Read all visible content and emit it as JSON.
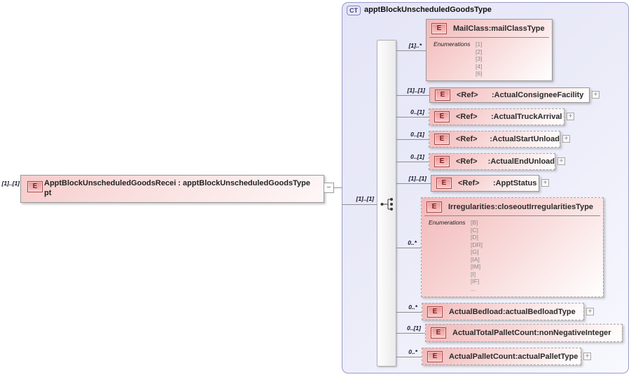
{
  "icons": {
    "element_badge": "E",
    "expander": "+",
    "collapser": "−"
  },
  "root": {
    "cardinality": "[1]..[1]",
    "display_line1": "ApptBlockUnscheduledGoodsRecei : apptBlockUnscheduledGoodsType",
    "display_line2": "pt"
  },
  "ct": {
    "badge": "CT",
    "title": "apptBlockUnscheduledGoodsType",
    "sequence_cardinality": "[1]..[1]",
    "children": [
      {
        "cardinality": "[1]..*",
        "name": "MailClass",
        "sep": " : ",
        "type": "mailClassType",
        "ref": false,
        "optional": false,
        "expander": false,
        "enumerations_label": "Enumerations",
        "enumerations": [
          "[1]",
          "[2]",
          "[3]",
          "[4]",
          "[6]"
        ]
      },
      {
        "cardinality": "[1]..[1]",
        "name": "<Ref>",
        "sep": ": ",
        "type": "ActualConsigneeFacility",
        "ref": true,
        "optional": false,
        "expander": true
      },
      {
        "cardinality": "0..[1]",
        "name": "<Ref>",
        "sep": ": ",
        "type": "ActualTruckArrival",
        "ref": true,
        "optional": true,
        "expander": true
      },
      {
        "cardinality": "0..[1]",
        "name": "<Ref>",
        "sep": ": ",
        "type": "ActualStartUnload",
        "ref": true,
        "optional": true,
        "expander": true
      },
      {
        "cardinality": "0..[1]",
        "name": "<Ref>",
        "sep": ": ",
        "type": "ActualEndUnload",
        "ref": true,
        "optional": true,
        "expander": true
      },
      {
        "cardinality": "[1]..[1]",
        "name": "<Ref>",
        "sep": ": ",
        "type": "ApptStatus",
        "ref": true,
        "optional": false,
        "expander": true
      },
      {
        "cardinality": "0..*",
        "name": "Irregularities",
        "sep": " : ",
        "type": "closeoutIrregularitiesType",
        "ref": false,
        "optional": true,
        "expander": false,
        "enumerations_label": "Enumerations",
        "enumerations": [
          "[B]",
          "[C]",
          "[D]",
          "[DR]",
          "[G]",
          "[IA]",
          "[IM]",
          "[I]",
          "[IF]",
          "..."
        ]
      },
      {
        "cardinality": "0..*",
        "name": "ActualBedload",
        "sep": " : ",
        "type": "actualBedloadType",
        "ref": false,
        "optional": true,
        "expander": true
      },
      {
        "cardinality": "0..[1]",
        "name": "ActualTotalPalletCount",
        "sep": " : ",
        "type": "nonNegativeInteger",
        "ref": false,
        "optional": true,
        "expander": false
      },
      {
        "cardinality": "0..*",
        "name": "ActualPalletCount",
        "sep": " : ",
        "type": "actualPalletType",
        "ref": false,
        "optional": true,
        "expander": true
      }
    ]
  }
}
